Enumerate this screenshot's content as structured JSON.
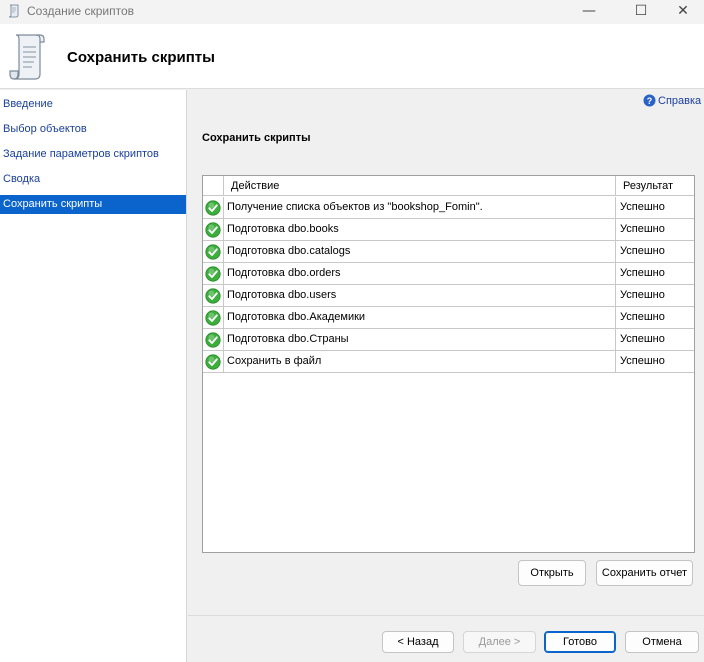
{
  "window": {
    "title": "Создание скриптов",
    "controls": {
      "minimize": "—",
      "maximize": "☐",
      "close": "✕"
    }
  },
  "header": {
    "title": "Сохранить скрипты",
    "icon": "script-scroll-icon"
  },
  "nav": {
    "items": [
      {
        "label": "Введение",
        "active": false
      },
      {
        "label": "Выбор объектов",
        "active": false
      },
      {
        "label": "Задание параметров скриптов",
        "active": false
      },
      {
        "label": "Сводка",
        "active": false
      },
      {
        "label": "Сохранить скрипты",
        "active": true
      }
    ]
  },
  "help": {
    "label": "Справка",
    "icon": "help-icon"
  },
  "main": {
    "section_title": "Сохранить скрипты",
    "grid": {
      "columns": [
        "Действие",
        "Результат"
      ],
      "rows": [
        {
          "action": "Получение списка объектов из \"bookshop_Fomin\".",
          "result": "Успешно",
          "icon": "success-check-icon"
        },
        {
          "action": "Подготовка dbo.books",
          "result": "Успешно",
          "icon": "success-check-icon"
        },
        {
          "action": "Подготовка dbo.catalogs",
          "result": "Успешно",
          "icon": "success-check-icon"
        },
        {
          "action": "Подготовка dbo.orders",
          "result": "Успешно",
          "icon": "success-check-icon"
        },
        {
          "action": "Подготовка dbo.users",
          "result": "Успешно",
          "icon": "success-check-icon"
        },
        {
          "action": "Подготовка dbo.Академики",
          "result": "Успешно",
          "icon": "success-check-icon"
        },
        {
          "action": "Подготовка dbo.Страны",
          "result": "Успешно",
          "icon": "success-check-icon"
        },
        {
          "action": "Сохранить в файл",
          "result": "Успешно",
          "icon": "success-check-icon"
        }
      ]
    },
    "open_label": "Открыть",
    "save_report_label": "Сохранить отчет"
  },
  "footer": {
    "back_label": "< Назад",
    "next_label": "Далее >",
    "finish_label": "Готово",
    "cancel_label": "Отмена"
  },
  "colors": {
    "accent": "#0a64cc",
    "link": "#1a3f9c",
    "success": "#3cae3c"
  }
}
